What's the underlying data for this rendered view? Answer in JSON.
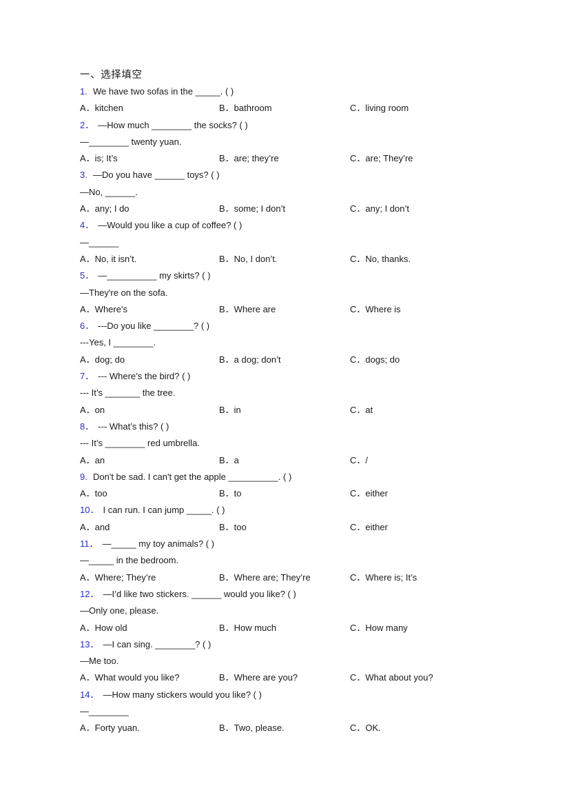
{
  "document": {
    "section_title": "一、选择填空",
    "option_labels": [
      "A．",
      "B．",
      "C．"
    ],
    "questions": [
      {
        "number": "1.",
        "lines": [
          "We have two sofas in the _____. (  )"
        ],
        "options": [
          "kitchen",
          "bathroom",
          "living room"
        ]
      },
      {
        "number": "2．",
        "lines": [
          "—How much ________ the socks? (  )",
          "—________ twenty yuan."
        ],
        "options": [
          "is; It’s",
          "are; they’re",
          "are; They’re"
        ]
      },
      {
        "number": "3.",
        "lines": [
          "—Do you have ______ toys? (  )",
          "—No, ______."
        ],
        "options": [
          "any; I do",
          "some; I don’t",
          "any; I don’t"
        ]
      },
      {
        "number": "4．",
        "lines": [
          "—Would you like a cup of coffee? (  )",
          "—______"
        ],
        "options": [
          "No, it isn’t.",
          "No, I don’t.",
          "No, thanks."
        ]
      },
      {
        "number": "5．",
        "lines": [
          "—__________ my skirts? (  )",
          "—They're on the sofa."
        ],
        "options": [
          "Where's",
          "Where are",
          "Where is"
        ]
      },
      {
        "number": "6．",
        "lines": [
          "---Do you like ________? (  )",
          "---Yes, I ________."
        ],
        "options": [
          "dog; do",
          "a dog; don’t",
          "dogs; do"
        ]
      },
      {
        "number": "7．",
        "lines": [
          "--- Where’s the bird? (   )",
          "--- It’s _______ the tree."
        ],
        "options": [
          "on",
          "in",
          "at"
        ]
      },
      {
        "number": "8．",
        "lines": [
          "--- What’s this? (   )",
          "--- It’s ________ red umbrella."
        ],
        "options": [
          "an",
          "a",
          "/"
        ]
      },
      {
        "number": "9.",
        "lines": [
          "Don't be sad. I can't get the apple __________. (  )"
        ],
        "options": [
          "too",
          "to",
          "either"
        ]
      },
      {
        "number": "10．",
        "lines": [
          "I can run. I can jump _____. (  )"
        ],
        "options": [
          "and",
          "too",
          "either"
        ]
      },
      {
        "number": "11．",
        "lines": [
          "—_____ my toy animals? (   )",
          "—_____ in the bedroom."
        ],
        "options": [
          "Where; They’re",
          "Where are; They’re",
          "Where is; It’s"
        ]
      },
      {
        "number": "12．",
        "lines": [
          "—I’d like two stickers. ______ would you like? (   )",
          "—Only one, please."
        ],
        "options": [
          "How old",
          "How much",
          "How many"
        ]
      },
      {
        "number": "13．",
        "lines": [
          "—I can sing. ________? (   )",
          "—Me too."
        ],
        "options": [
          "What would you like?",
          "Where are you?",
          "What about you?"
        ]
      },
      {
        "number": "14．",
        "lines": [
          "—How many stickers would you like? (   )",
          "—________"
        ],
        "options": [
          "Forty yuan.",
          "Two, please.",
          "OK."
        ]
      }
    ]
  },
  "colors": {
    "question_number": "#2a2ad0",
    "body_text": "#1a1a1a",
    "page_background": "#ffffff"
  }
}
